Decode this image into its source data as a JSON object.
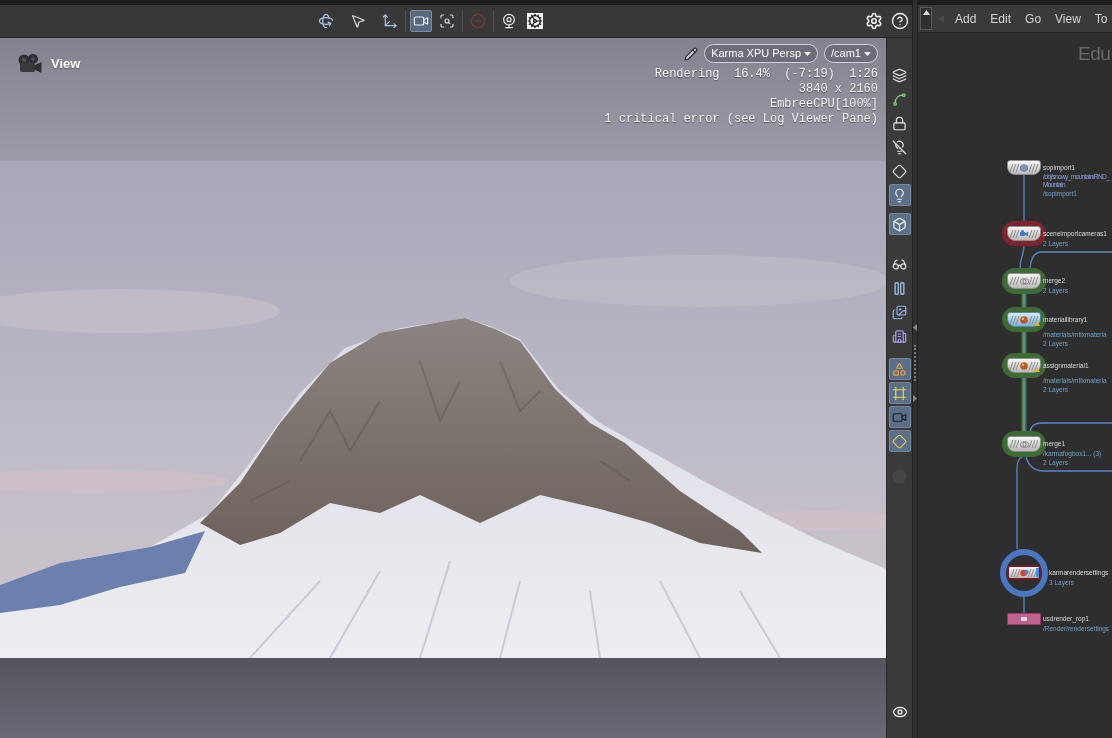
{
  "toolbar": {
    "groups": [
      {
        "tools": [
          {
            "selected": false,
            "disabled": false
          },
          {
            "selected": false,
            "disabled": false
          },
          {
            "selected": false,
            "disabled": false
          }
        ]
      },
      {
        "tools": [
          {
            "selected": true,
            "disabled": false
          },
          {
            "selected": false,
            "disabled": false
          }
        ]
      },
      {
        "tools": [
          {
            "selected": false,
            "disabled": true
          }
        ]
      },
      {
        "tools": [
          {
            "selected": false,
            "disabled": false
          },
          {
            "selected": false,
            "disabled": false
          }
        ]
      }
    ]
  },
  "viewport": {
    "title": "View",
    "renderer": "Karma XPU Persp",
    "camera": "/cam1",
    "stats": [
      "Rendering  16.4%  (-7:19)  1:26",
      "3840 x 2160",
      "EmbreeCPU[100%]",
      "1 critical error (see Log Viewer Pane)"
    ]
  },
  "display_bar": {
    "groups": [
      {
        "tools": [
          {
            "selected": false,
            "disabled": false
          },
          {
            "selected": false,
            "disabled": false
          },
          {
            "selected": false,
            "disabled": false
          },
          {
            "selected": false,
            "disabled": false
          },
          {
            "selected": false,
            "disabled": false
          },
          {
            "selected": true,
            "disabled": false
          }
        ]
      },
      {
        "tools": [
          {
            "selected": true,
            "disabled": false
          }
        ]
      },
      {
        "tools": [
          {
            "selected": false,
            "disabled": false
          },
          {
            "selected": false,
            "disabled": false
          },
          {
            "selected": false,
            "disabled": false
          },
          {
            "selected": false,
            "disabled": false
          }
        ]
      },
      {
        "tools": [
          {
            "selected": true,
            "disabled": false
          },
          {
            "selected": true,
            "disabled": false
          },
          {
            "selected": true,
            "disabled": false
          },
          {
            "selected": true,
            "disabled": false
          }
        ]
      },
      {
        "tools": [
          {
            "selected": false,
            "disabled": true
          }
        ]
      }
    ]
  },
  "network": {
    "menu": [
      "Add",
      "Edit",
      "Go",
      "View",
      "To"
    ],
    "label": "Edu",
    "nodes": [
      {
        "name": "sopimport1",
        "kind": "sop",
        "display": false,
        "warning": false,
        "details": [
          {
            "text": "/obj/snowy_mountain/RND_",
            "kind": "note"
          },
          {
            "text": "Mountain",
            "kind": "note"
          },
          {
            "text": "/sopimport1",
            "kind": "info"
          }
        ]
      },
      {
        "name": "sceneimportcameras1",
        "kind": "camera",
        "color": "#7e2330",
        "display": false,
        "warning": false,
        "details": [
          {
            "text": "2 Layers",
            "kind": "info"
          }
        ]
      },
      {
        "name": "merge2",
        "kind": "merge",
        "color": "#3e6a35",
        "display": false,
        "warning": false,
        "details": [
          {
            "text": "2 Layers",
            "kind": "info"
          }
        ]
      },
      {
        "name": "materiallibrary1",
        "kind": "matlib",
        "color": "#3e6a35",
        "display": false,
        "warning": true,
        "details": [
          {
            "text": "/materials/mtlxmateria",
            "kind": "info"
          },
          {
            "text": "2 Layers",
            "kind": "info"
          }
        ]
      },
      {
        "name": "assignmaterial1",
        "kind": "assign",
        "color": "#3e6a35",
        "display": false,
        "warning": true,
        "details": [
          {
            "text": "/materials/mtlxmateria",
            "kind": "info"
          },
          {
            "text": "2 Layers",
            "kind": "info"
          }
        ]
      },
      {
        "name": "merge1",
        "kind": "merge",
        "color": "#3e6a35",
        "display": false,
        "warning": false,
        "details": [
          {
            "text": "/karmafogbox1... (3)",
            "kind": "info"
          },
          {
            "text": "2 Layers",
            "kind": "info"
          }
        ]
      },
      {
        "name": "karmarendersettings",
        "kind": "render",
        "display": true,
        "warning": false,
        "details": [
          {
            "text": "3 Layers",
            "kind": "info"
          }
        ]
      },
      {
        "name": "usdrender_rop1",
        "kind": "rop",
        "display": false,
        "warning": false,
        "details": [
          {
            "text": "/Render/rendersettings",
            "kind": "info"
          }
        ]
      }
    ]
  }
}
